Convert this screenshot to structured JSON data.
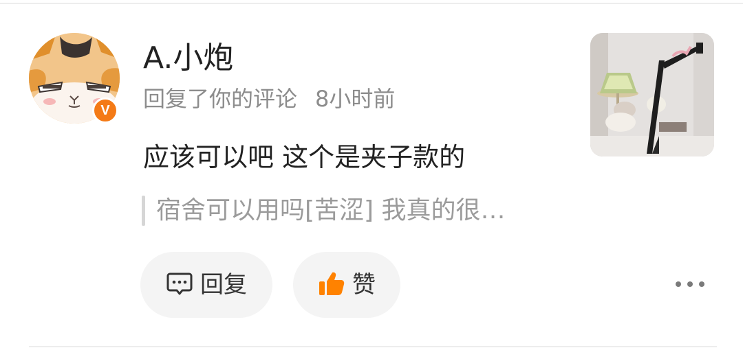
{
  "notification": {
    "user": {
      "name": "A.小炮",
      "verified_badge_text": "V",
      "badge_color": "#f47a16"
    },
    "meta": {
      "action": "回复了你的评论",
      "time": "8小时前"
    },
    "comment": "应该可以吧 这个是夹子款的",
    "quoted_comment": "宿舍可以用吗[苦涩] 我真的很…",
    "actions": {
      "reply_label": "回复",
      "like_label": "赞"
    },
    "icons": {
      "reply": "comment-bubble-icon",
      "like": "thumbs-up-icon",
      "more": "more-dots-icon"
    }
  }
}
